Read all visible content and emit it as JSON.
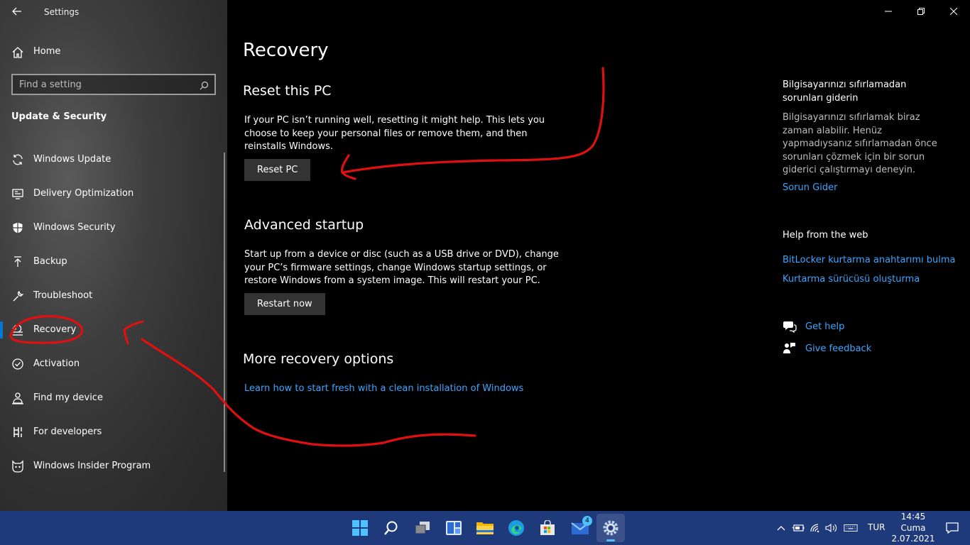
{
  "app": {
    "title": "Settings"
  },
  "sidebar": {
    "home_label": "Home",
    "search_placeholder": "Find a setting",
    "section_title": "Update & Security",
    "items": [
      {
        "label": "Windows Update",
        "icon": "sync-icon"
      },
      {
        "label": "Delivery Optimization",
        "icon": "delivery-optimization-icon"
      },
      {
        "label": "Windows Security",
        "icon": "shield-icon"
      },
      {
        "label": "Backup",
        "icon": "backup-arrow-icon"
      },
      {
        "label": "Troubleshoot",
        "icon": "wrench-icon"
      },
      {
        "label": "Recovery",
        "icon": "recovery-icon",
        "selected": true
      },
      {
        "label": "Activation",
        "icon": "check-circle-icon"
      },
      {
        "label": "Find my device",
        "icon": "person-location-icon"
      },
      {
        "label": "For developers",
        "icon": "developer-tools-icon"
      },
      {
        "label": "Windows Insider Program",
        "icon": "insider-cat-icon"
      }
    ]
  },
  "main": {
    "title": "Recovery",
    "reset": {
      "heading": "Reset this PC",
      "description": "If your PC isn’t running well, resetting it might help. This lets you choose to keep your personal files or remove them, and then reinstalls Windows.",
      "button": "Reset PC"
    },
    "advanced": {
      "heading": "Advanced startup",
      "description": "Start up from a device or disc (such as a USB drive or DVD), change your PC’s firmware settings, change Windows startup settings, or restore Windows from a system image. This will restart your PC.",
      "button": "Restart now"
    },
    "more": {
      "heading": "More recovery options",
      "link": "Learn how to start fresh with a clean installation of Windows"
    }
  },
  "right_panel": {
    "troubleshoot_title": "Bilgisayarınızı sıfırlamadan sorunları giderin",
    "troubleshoot_text": "Bilgisayarınızı sıfırlamak biraz zaman alabilir. Henüz yapmadıysanız sıfırlamadan önce sorunları çözmek için bir sorun giderici çalıştırmayı deneyin.",
    "troubleshoot_link": "Sorun Gider",
    "web_title": "Help from the web",
    "web_links": [
      "BitLocker kurtarma anahtarımı bulma",
      "Kurtarma sürücüsü oluşturma"
    ],
    "get_help": "Get help",
    "give_feedback": "Give feedback"
  },
  "taskbar": {
    "apps": [
      "start-icon",
      "search-icon",
      "task-view-icon",
      "widgets-icon",
      "file-explorer-icon",
      "edge-icon",
      "store-icon",
      "mail-icon",
      "settings-icon"
    ],
    "mail_badge": "4",
    "language": "TUR",
    "time": "14:45",
    "day": "Cuma",
    "date": "2.07.2021"
  },
  "colors": {
    "accent": "#0078d4",
    "link": "#3ca5ff",
    "annotation": "#e01010",
    "taskbar": "#1f3a7a"
  }
}
